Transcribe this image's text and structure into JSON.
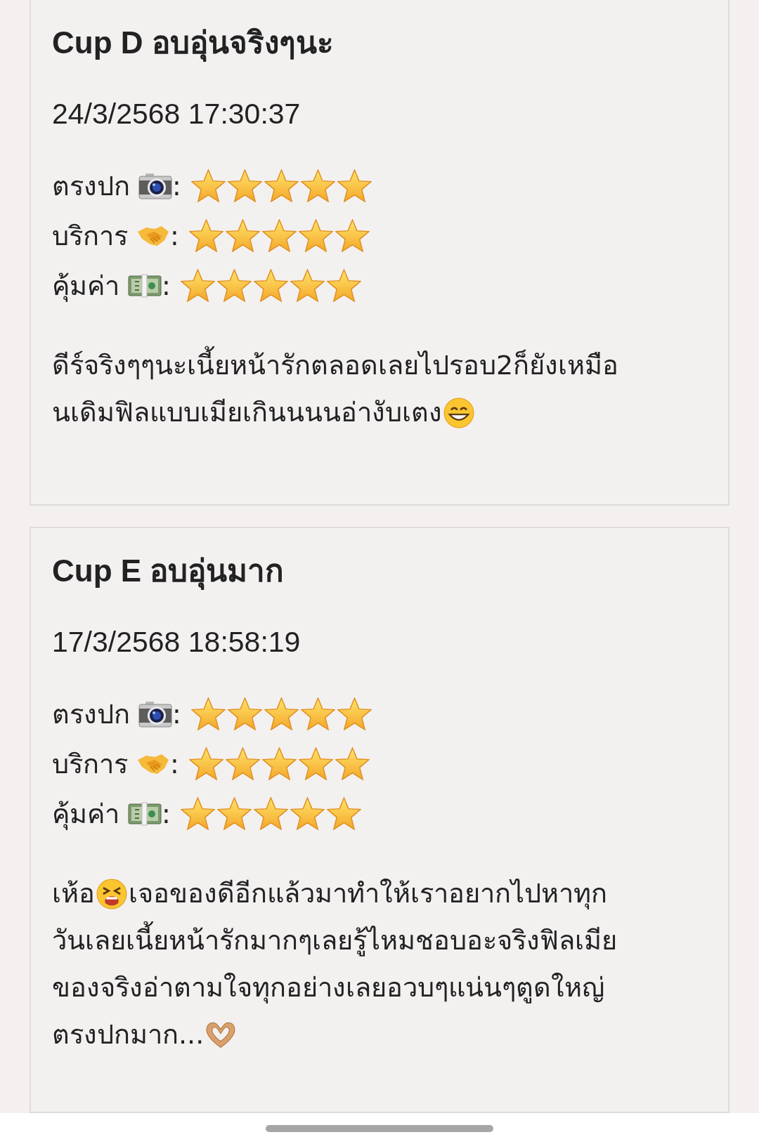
{
  "reviews": [
    {
      "title": "Cup D อบอุ่นจริงๆนะ",
      "date": "24/3/2568 17:30:37",
      "ratings": [
        {
          "label": "ตรงปก",
          "kind": "camera",
          "suffix": ":",
          "stars": 5
        },
        {
          "label": "บริการ",
          "kind": "handshake",
          "suffix": ":",
          "stars": 5
        },
        {
          "label": "คุ้มค่า",
          "kind": "cash",
          "suffix": ":",
          "stars": 5
        }
      ],
      "body": [
        [
          {
            "kind": "text",
            "text": "ดีร์จริงๆๆนะเนี้ยหน้ารักตลอดเลยไปรอบ2ก็ยังเหมือ"
          }
        ],
        [
          {
            "kind": "text",
            "text": "นเดิมฟิลแบบเมียเกินนนนอ่างับเตง"
          },
          {
            "kind": "grin"
          }
        ]
      ]
    },
    {
      "title": "Cup E อบอุ่นมาก",
      "date": "17/3/2568 18:58:19",
      "ratings": [
        {
          "label": "ตรงปก",
          "kind": "camera",
          "suffix": ":",
          "stars": 5
        },
        {
          "label": "บริการ",
          "kind": "handshake",
          "suffix": ":",
          "stars": 5
        },
        {
          "label": "คุ้มค่า",
          "kind": "cash",
          "suffix": ":",
          "stars": 5
        }
      ],
      "body": [
        [
          {
            "kind": "text",
            "text": "เห้อ"
          },
          {
            "kind": "tired"
          },
          {
            "kind": "text",
            "text": "เจอของดีอีกแล้วมาทำให้เราอยากไปหาทุก"
          }
        ],
        [
          {
            "kind": "text",
            "text": "วันเลยเนี้ยหน้ารักมากๆเลยรู้ไหมชอบอะจริงฟิลเมีย"
          }
        ],
        [
          {
            "kind": "text",
            "text": "ของจริงอ่าตามใจทุกอย่างเลยอวบๆแน่นๆตูดใหญ่"
          }
        ],
        [
          {
            "kind": "text",
            "text": "ตรงปกมาก..."
          },
          {
            "kind": "hearthands"
          }
        ]
      ]
    }
  ]
}
